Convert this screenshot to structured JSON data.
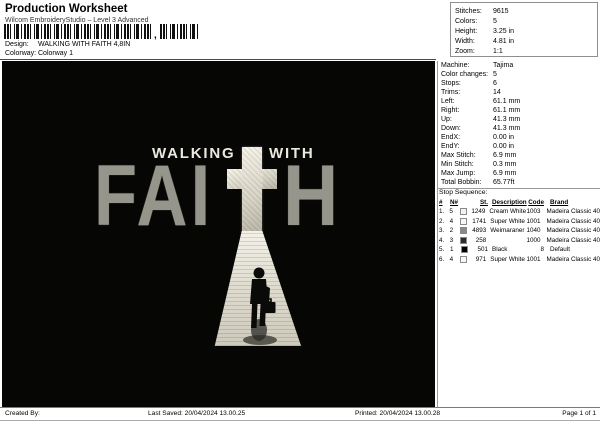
{
  "header": {
    "title": "Production Worksheet",
    "subtitle": "Wilcom EmbroideryStudio – Level 3 Advanced",
    "design_label": "Design:",
    "design_value": "WALKING WITH FAITH 4,8IN",
    "colorway_label": "Colorway:",
    "colorway_value": "Colorway 1",
    "barcode_comma": ","
  },
  "stats_box": {
    "rows": [
      {
        "label": "Stitches:",
        "value": "9615"
      },
      {
        "label": "Colors:",
        "value": "5"
      },
      {
        "label": "Height:",
        "value": "3.25 in"
      },
      {
        "label": "Width:",
        "value": "4.81 in"
      },
      {
        "label": "Zoom:",
        "value": "1:1"
      }
    ]
  },
  "machine_info": {
    "rows": [
      {
        "label": "Machine:",
        "value": "Tajima"
      },
      {
        "label": "Color changes:",
        "value": "5"
      },
      {
        "label": "Stops:",
        "value": "6"
      },
      {
        "label": "Trims:",
        "value": "14"
      },
      {
        "label": "Left:",
        "value": "61.1 mm"
      },
      {
        "label": "Right:",
        "value": "61.1 mm"
      },
      {
        "label": "Up:",
        "value": "41.3 mm"
      },
      {
        "label": "Down:",
        "value": "41.3 mm"
      },
      {
        "label": "EndX:",
        "value": "0.00 in"
      },
      {
        "label": "EndY:",
        "value": "0.00 in"
      },
      {
        "label": "Max Stitch:",
        "value": "6.9 mm"
      },
      {
        "label": "Min Stitch:",
        "value": "0.3 mm"
      },
      {
        "label": "Max Jump:",
        "value": "6.9 mm"
      },
      {
        "label": "Total Bobbin:",
        "value": "65.77ft"
      }
    ]
  },
  "stop_sequence": {
    "title": "Stop Sequence:",
    "columns": [
      "#",
      "N#",
      "St.",
      "Description",
      "Code",
      "Brand"
    ],
    "rows": [
      {
        "num": "1.",
        "n": "5",
        "swatch": "#f5f3e8",
        "st": "1249",
        "desc": "Cream White",
        "code": "1003",
        "brand": "Madeira Classic 40"
      },
      {
        "num": "2.",
        "n": "4",
        "swatch": "#f6f9fb",
        "st": "1741",
        "desc": "Super White",
        "code": "1001",
        "brand": "Madeira Classic 40"
      },
      {
        "num": "3.",
        "n": "2",
        "swatch": "#8b8b84",
        "st": "4893",
        "desc": "Weimaraner",
        "code": "1040",
        "brand": "Madeira Classic 40"
      },
      {
        "num": "4.",
        "n": "3",
        "swatch": "#2e2e2a",
        "st": "258",
        "desc": "",
        "code": "1000",
        "brand": "Madeira Classic 40"
      },
      {
        "num": "5.",
        "n": "1",
        "swatch": "#000000",
        "st": "501",
        "desc": "Black",
        "code": "8",
        "brand": "Default"
      },
      {
        "num": "6.",
        "n": "4",
        "swatch": "#f6f9fb",
        "st": "971",
        "desc": "Super White",
        "code": "1001",
        "brand": "Madeira Classic 40"
      }
    ]
  },
  "design_preview": {
    "word1": "WALKING",
    "word2": "WITH",
    "faith_left": "FAI",
    "faith_right": "H",
    "colors": {
      "background": "#060605",
      "light_text": "#ebe8df",
      "gray_text": "#95958b",
      "cross": "#e8e4d7",
      "beam": "#e6e3d7"
    }
  },
  "footer": {
    "created_label": "Created By:",
    "last_saved": "Last Saved: 20/04/2024 13.00.25",
    "printed": "Printed: 20/04/2024 13.00.28",
    "page": "Page 1 of 1"
  }
}
